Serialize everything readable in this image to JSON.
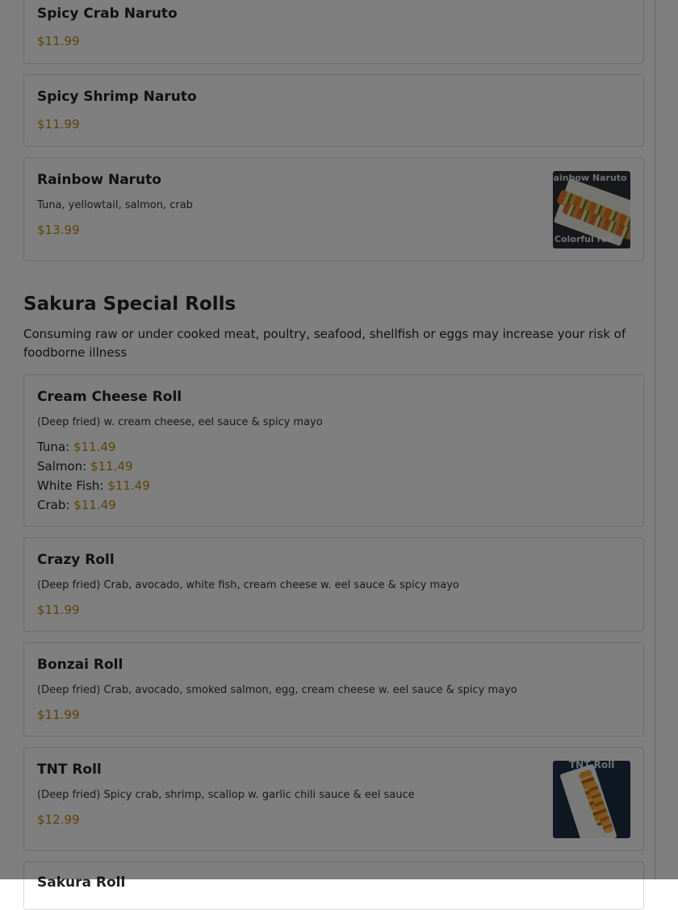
{
  "menu": {
    "cards_top": [
      {
        "title": "Spicy Crab Naruto",
        "price": "$11.99"
      },
      {
        "title": "Spicy Shrimp Naruto",
        "price": "$11.99"
      },
      {
        "title": "Rainbow Naruto",
        "description": "Tuna, yellowtail, salmon, crab",
        "price": "$13.99",
        "image_caption_top": "Rainbow Naruto",
        "image_caption_bottom": "Colorful roll"
      }
    ],
    "section": {
      "title": "Sakura Special Rolls",
      "note": "Consuming raw or under cooked meat, poultry, seafood, shellfish or eggs may increase your risk of foodborne illness"
    },
    "cream_cheese_roll": {
      "title": "Cream Cheese Roll",
      "description": "(Deep fried) w. cream cheese, eel sauce & spicy mayo",
      "options": [
        {
          "label": "Tuna:",
          "price": "$11.49"
        },
        {
          "label": "Salmon:",
          "price": "$11.49"
        },
        {
          "label": "White Fish:",
          "price": "$11.49"
        },
        {
          "label": "Crab:",
          "price": "$11.49"
        }
      ]
    },
    "crazy_roll": {
      "title": "Crazy Roll",
      "description": "(Deep fried) Crab, avocado, white fish, cream cheese w. eel sauce & spicy mayo",
      "price": "$11.99"
    },
    "bonzai_roll": {
      "title": "Bonzai Roll",
      "description": "(Deep fried) Crab, avocado, smoked salmon, egg, cream cheese w. eel sauce & spicy mayo",
      "price": "$11.99"
    },
    "tnt_roll": {
      "title": "TNT Roll",
      "description": "(Deep fried) Spicy crab, shrimp, scallop w. garlic chili sauce & eel sauce",
      "price": "$12.99",
      "image_caption": "TNT Roll"
    },
    "next_card": {
      "title": "Sakura Roll"
    }
  },
  "colors": {
    "price": "#b8860b",
    "overlay": "rgba(0,0,0,0.5)"
  }
}
